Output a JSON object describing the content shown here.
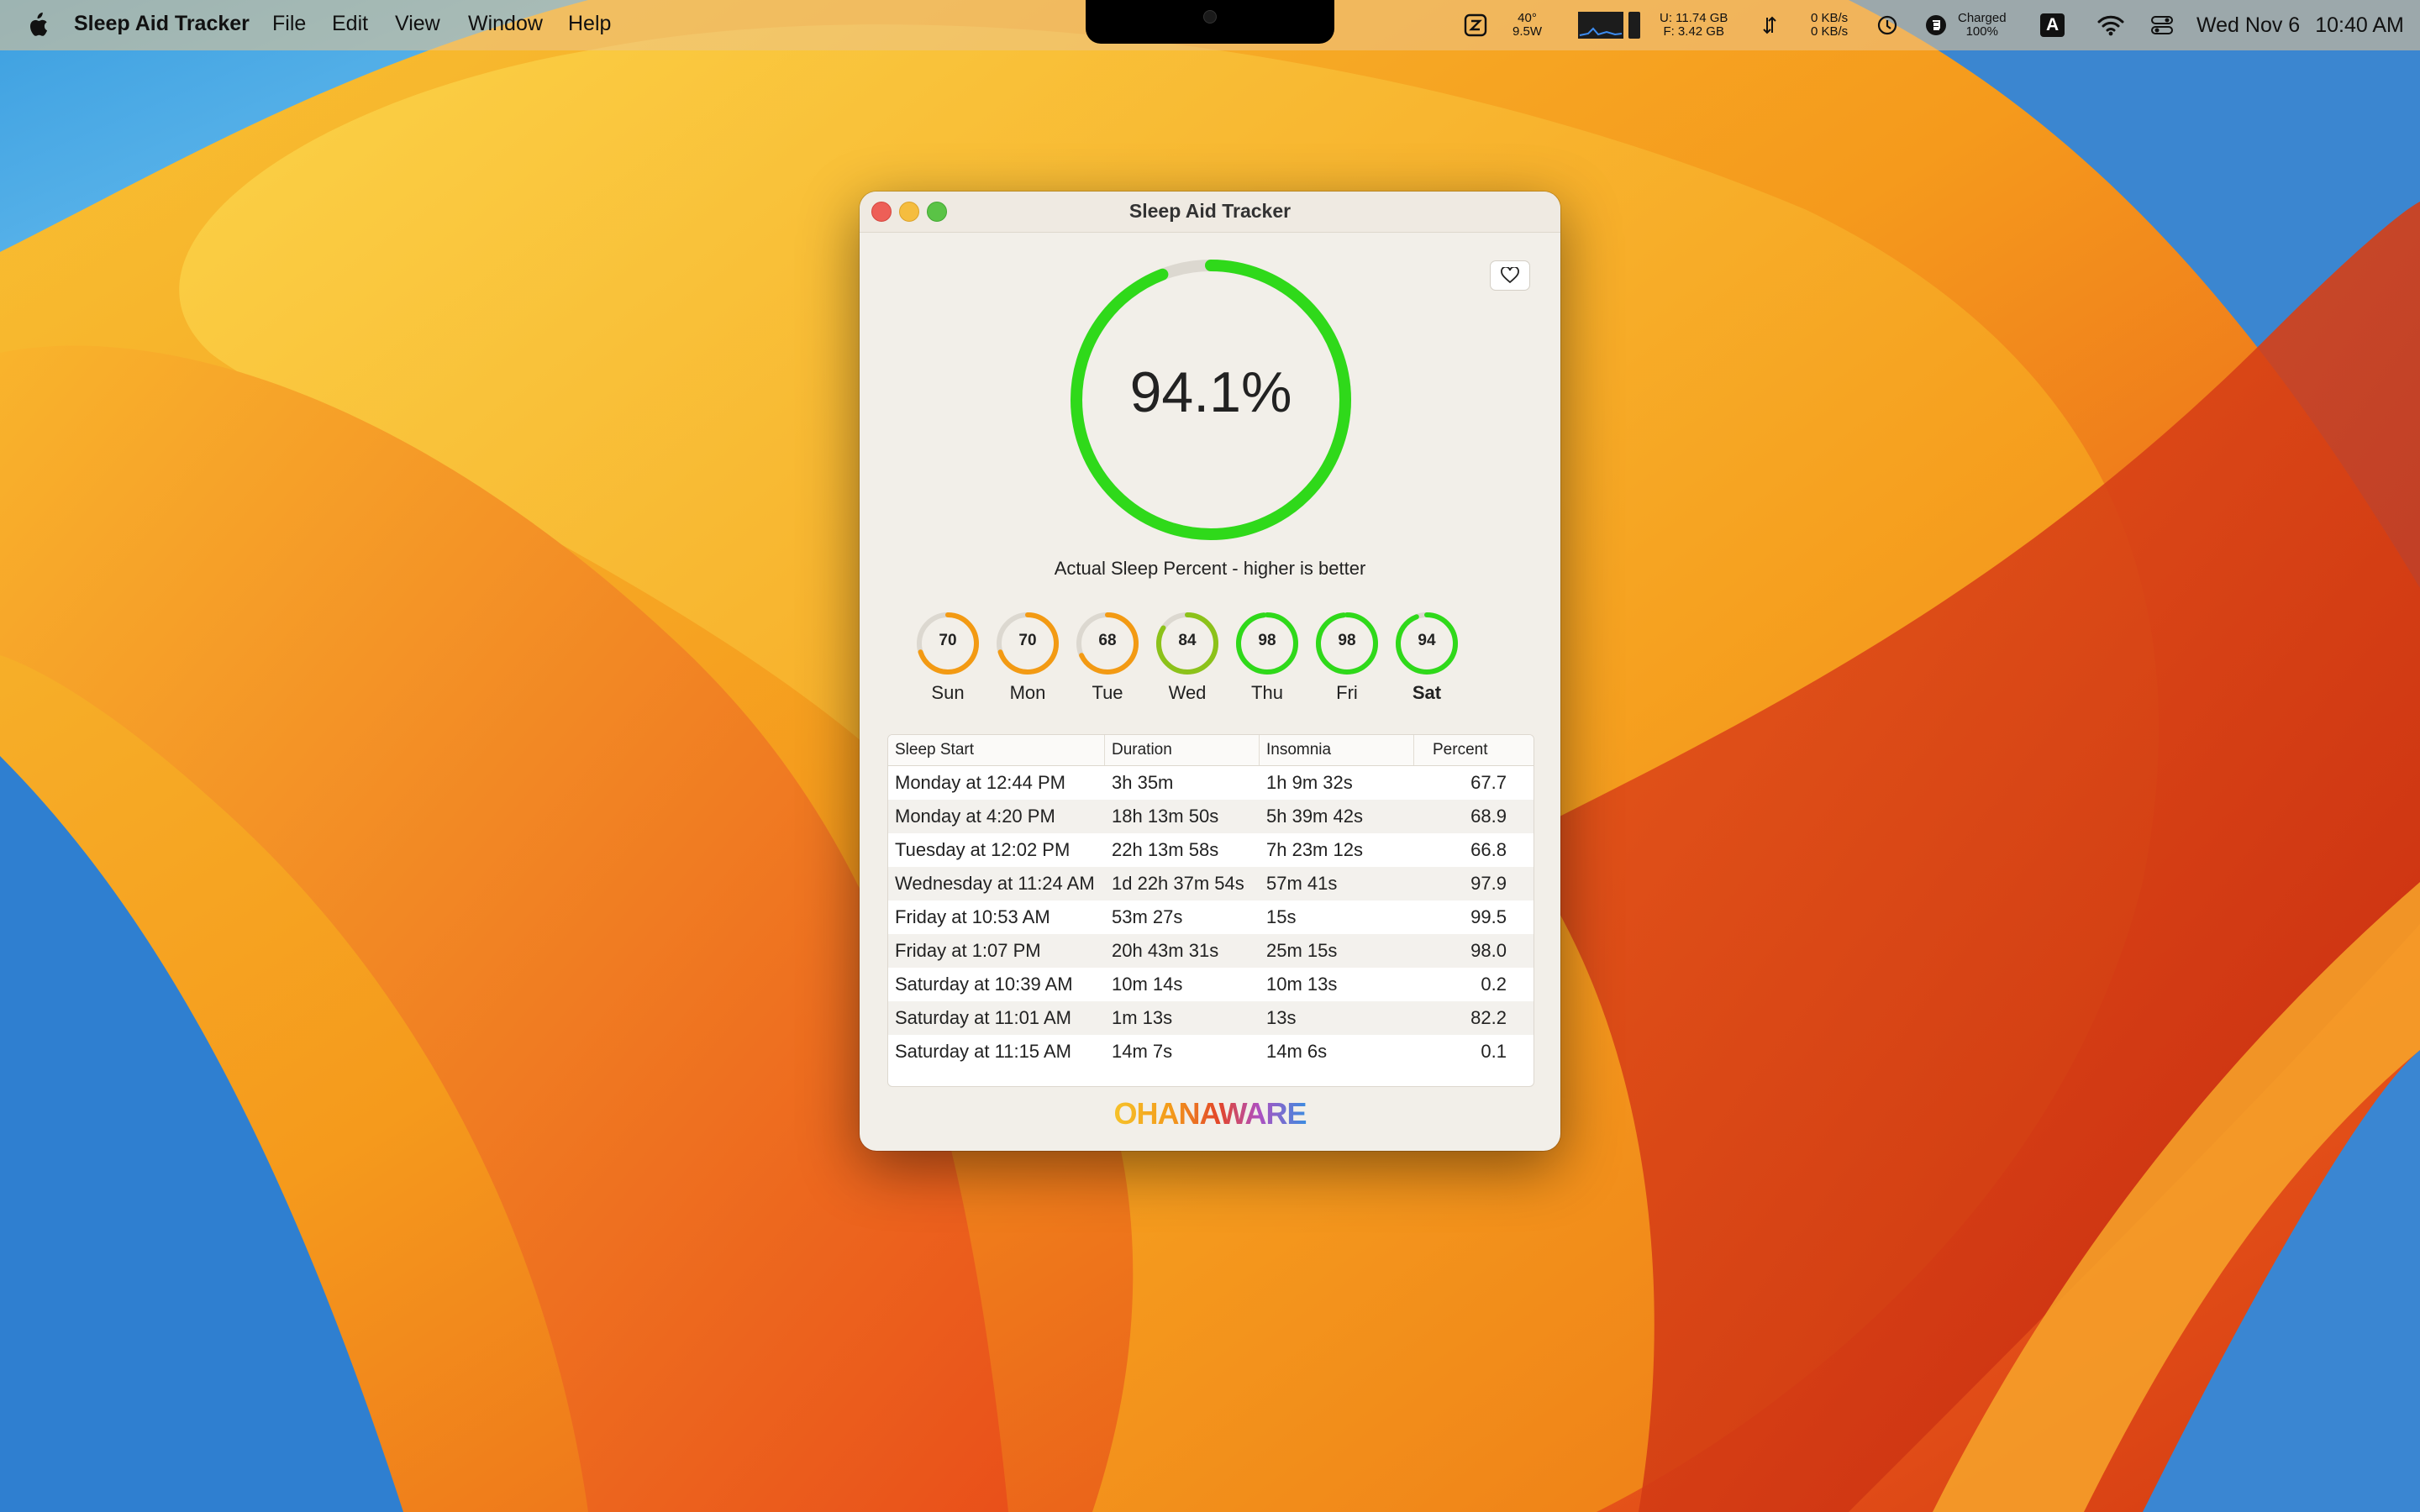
{
  "menubar": {
    "app_name": "Sleep Aid Tracker",
    "menus": [
      "File",
      "Edit",
      "View",
      "Window",
      "Help"
    ],
    "status": {
      "temp": "40°",
      "power": "9.5W",
      "mem_u": "U: 11.74 GB",
      "mem_f": "F: 3.42 GB",
      "net_up": "0 KB/s",
      "net_down": "0 KB/s",
      "battery_status": "Charged",
      "battery_pct": "100%",
      "input_source": "A",
      "date": "Wed Nov 6",
      "time": "10:40 AM"
    }
  },
  "window": {
    "title": "Sleep Aid Tracker",
    "overall_percent_label": "94.1%",
    "overall_percent": 94.1,
    "subtitle": "Actual Sleep Percent - higher is better",
    "days": [
      {
        "label": "Sun",
        "value": "70",
        "level": 70,
        "color": "#f39a13",
        "bold": false
      },
      {
        "label": "Mon",
        "value": "70",
        "level": 70,
        "color": "#f39a13",
        "bold": false
      },
      {
        "label": "Tue",
        "value": "68",
        "level": 68,
        "color": "#f39a13",
        "bold": false
      },
      {
        "label": "Wed",
        "value": "84",
        "level": 84,
        "color": "#8cc21a",
        "bold": false
      },
      {
        "label": "Thu",
        "value": "98",
        "level": 98,
        "color": "#2fd91a",
        "bold": false
      },
      {
        "label": "Fri",
        "value": "98",
        "level": 98,
        "color": "#2fd91a",
        "bold": false
      },
      {
        "label": "Sat",
        "value": "94",
        "level": 94,
        "color": "#2fd91a",
        "bold": true
      }
    ],
    "table": {
      "headers": [
        "Sleep Start",
        "Duration",
        "Insomnia",
        "Percent"
      ],
      "rows": [
        [
          "Monday at 12:44 PM",
          "3h 35m",
          "1h 9m 32s",
          "67.7"
        ],
        [
          "Monday at 4:20 PM",
          "18h 13m 50s",
          "5h 39m 42s",
          "68.9"
        ],
        [
          "Tuesday at 12:02 PM",
          "22h 13m 58s",
          "7h 23m 12s",
          "66.8"
        ],
        [
          "Wednesday at 11:24 AM",
          "1d 22h 37m 54s",
          "57m 41s",
          "97.9"
        ],
        [
          "Friday at 10:53 AM",
          "53m 27s",
          "15s",
          "99.5"
        ],
        [
          "Friday at 1:07 PM",
          "20h 43m 31s",
          "25m 15s",
          "98.0"
        ],
        [
          "Saturday at 10:39 AM",
          "10m 14s",
          "10m 13s",
          "0.2"
        ],
        [
          "Saturday at 11:01 AM",
          "1m 13s",
          "13s",
          "82.2"
        ],
        [
          "Saturday at 11:15 AM",
          "14m 7s",
          "14m 6s",
          "0.1"
        ]
      ]
    },
    "logo_text": "OHANAWARE",
    "ring_color": "#2fd91a",
    "ring_track_color": "#dcd8d0"
  }
}
